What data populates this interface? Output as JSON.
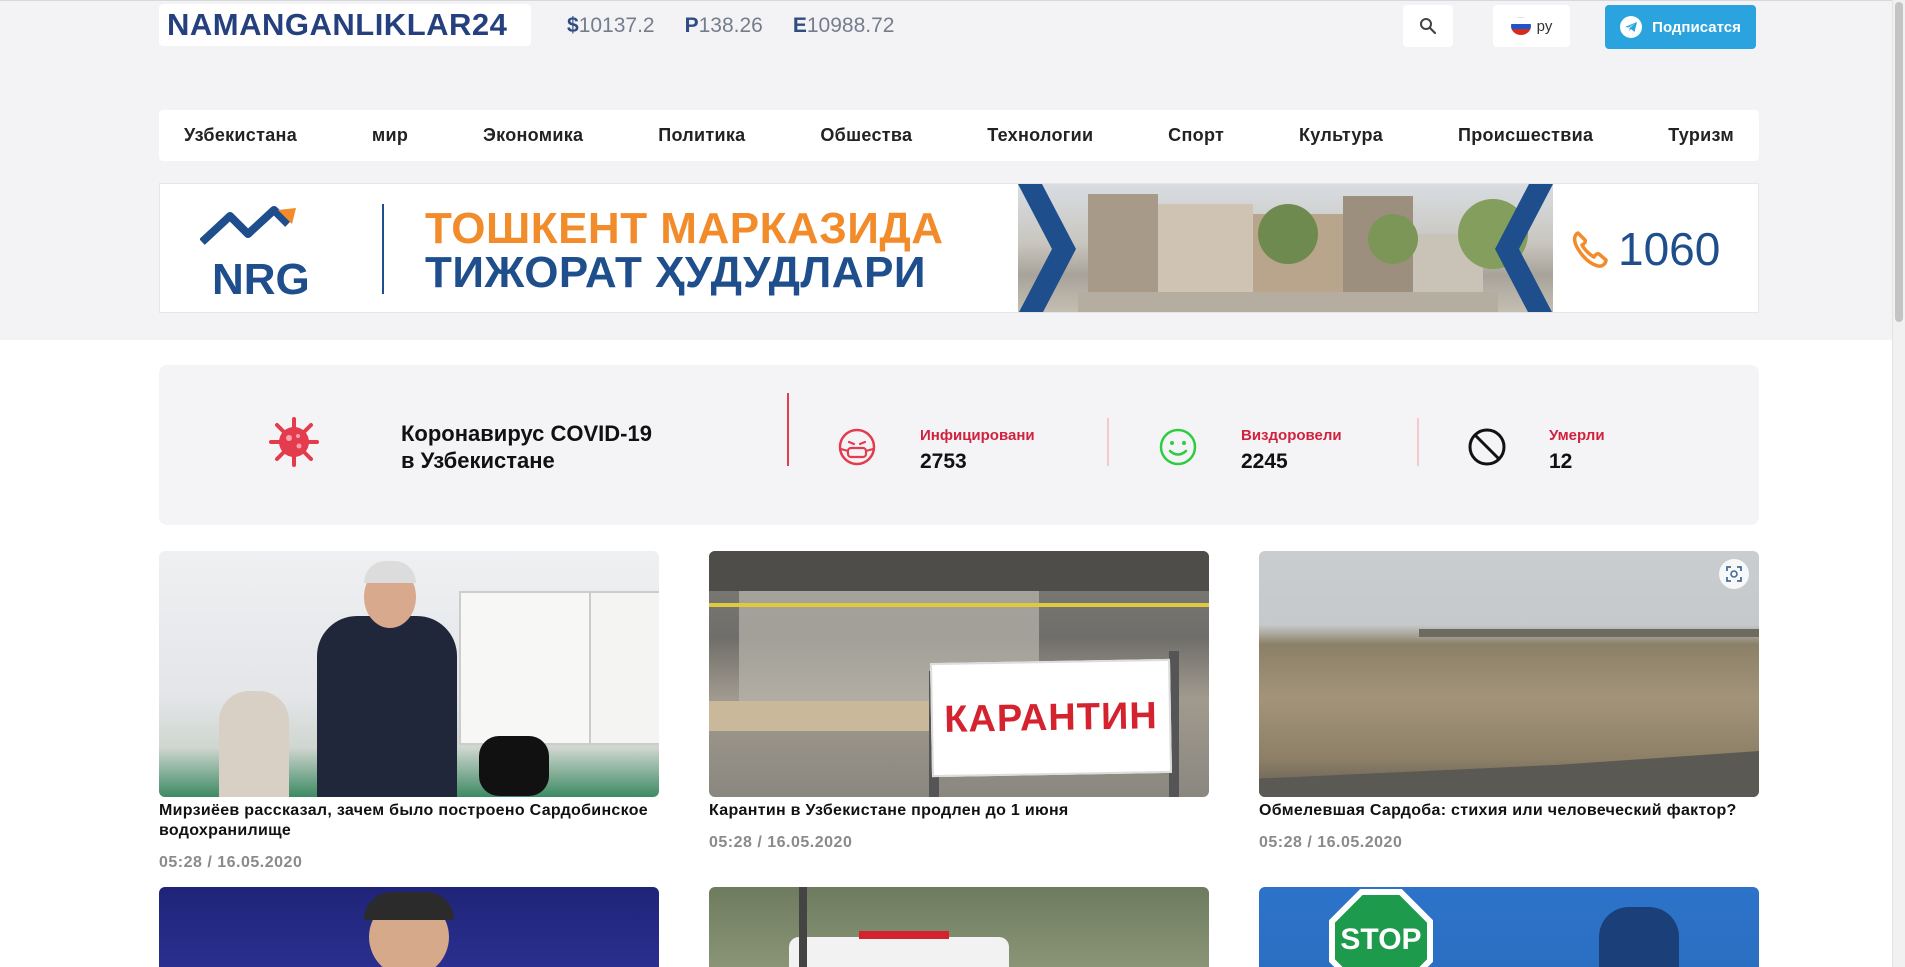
{
  "header": {
    "logo": "NAMANGANLIKLAR24",
    "rates": [
      {
        "symbol": "$",
        "value": "10137.2"
      },
      {
        "symbol": "P",
        "value": "138.26"
      },
      {
        "symbol": "E",
        "value": "10988.72"
      }
    ],
    "language": "ру",
    "subscribe": "Подписатся",
    "icons": {
      "search": "search-icon",
      "flag": "russia-flag-icon",
      "telegram": "telegram-icon"
    }
  },
  "nav": {
    "items": [
      "Узбекистана",
      "мир",
      "Экономика",
      "Политика",
      "Обшества",
      "Технологии",
      "Спорт",
      "Культура",
      "Происшествиа",
      "Туризм"
    ]
  },
  "banner": {
    "logo_text": "NRG",
    "line1": "ТОШКЕНТ МАРКАЗИДА",
    "line2": "ТИЖОРАТ ҲУДУДЛАРИ",
    "phone": "1060",
    "colors": {
      "orange": "#f28b2a",
      "blue": "#1f4e8c"
    }
  },
  "covid": {
    "title_line1": "Коронавирус COVID-19",
    "title_line2": "в Узбекистане",
    "stats": [
      {
        "label": "Инфицировани",
        "value": "2753",
        "icon": "sick-face-mask-icon",
        "color": "#e43b4d"
      },
      {
        "label": "Виздоровели",
        "value": "2245",
        "icon": "smile-face-icon",
        "color": "#2ecc40"
      },
      {
        "label": "Умерли",
        "value": "12",
        "icon": "no-entry-icon",
        "color": "#111111"
      }
    ]
  },
  "news": [
    {
      "title": "Мирзиёев рассказал, зачем было построено Сардобинское водохранилище",
      "date": "05:28 / 16.05.2020"
    },
    {
      "title": "Карантин в Узбекистане продлен до 1 июня",
      "date": "05:28 / 16.05.2020",
      "sign_text": "КАРАНТИН"
    },
    {
      "title": "Обмелевшая Сардоба: стихия или человеческий фактор?",
      "date": "05:28 / 16.05.2020"
    }
  ],
  "bottom_thumbs": {
    "stop_sign": "STOP"
  }
}
